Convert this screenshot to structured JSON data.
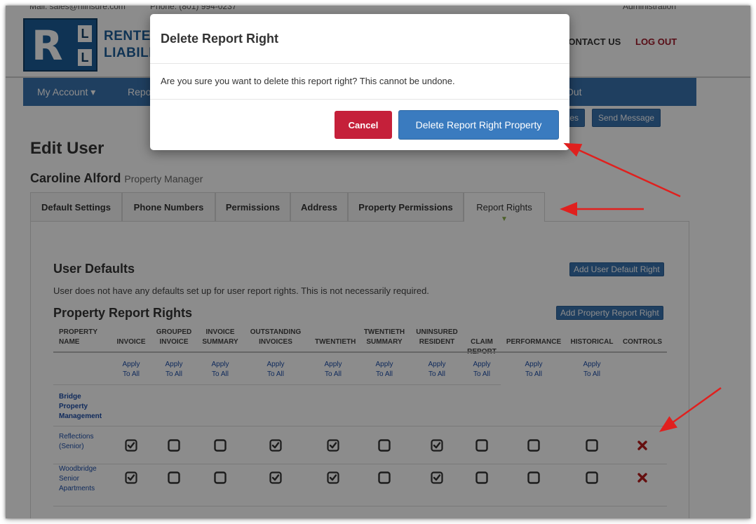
{
  "topbar": {
    "email": "Mail: sales@rllinsure.com",
    "phone": "Phone: (801) 994-0237",
    "admin": "Administration"
  },
  "logo": {
    "letters": {
      "big": "R",
      "small_top": "L",
      "small_bottom": "L"
    },
    "line1": "RENTE",
    "line2": "LIABILI"
  },
  "header_links": {
    "contact": "CONTACT US",
    "logout": "LOG OUT"
  },
  "nav": {
    "my_account": "My Account ▾",
    "reports": "Repo",
    "logout": "Out"
  },
  "toolbar": {
    "messages": "ges",
    "send_message": "Send Message"
  },
  "page": {
    "title": "Edit User",
    "user_name": "Caroline Alford",
    "user_role": "Property Manager"
  },
  "tabs": [
    "Default Settings",
    "Phone Numbers",
    "Permissions",
    "Address",
    "Property Permissions",
    "Report Rights"
  ],
  "active_tab": "Report Rights",
  "user_defaults": {
    "heading": "User Defaults",
    "message": "User does not have any defaults set up for user report rights. This is not necessarily required.",
    "add_button": "Add User Default Right"
  },
  "property_rights": {
    "heading": "Property Report Rights",
    "add_button": "Add Property Report Right",
    "columns": [
      "PROPERTY NAME",
      "INVOICE",
      "GROUPED INVOICE",
      "INVOICE SUMMARY",
      "OUTSTANDING INVOICES",
      "TWENTIETH",
      "TWENTIETH SUMMARY",
      "UNINSURED RESIDENT",
      "CLAIM REPORT",
      "PERFORMANCE",
      "HISTORICAL",
      "CONTROLS"
    ],
    "apply_label": "Apply To All",
    "group_name": "Bridge Property Management",
    "rows": [
      {
        "name": "Reflections (Senior)",
        "checks": [
          true,
          false,
          false,
          true,
          true,
          false,
          true,
          false,
          false,
          false
        ]
      },
      {
        "name": "Woodbridge Senior Apartments",
        "checks": [
          true,
          false,
          false,
          true,
          true,
          false,
          true,
          false,
          false,
          false
        ]
      }
    ]
  },
  "modal": {
    "title": "Delete Report Right",
    "body": "Are you sure you want to delete this report right? This cannot be undone.",
    "cancel": "Cancel",
    "confirm": "Delete Report Right Property"
  },
  "colors": {
    "nav_blue": "#3a73b0",
    "cancel_red": "#c5203a",
    "confirm_blue": "#3a7bbf",
    "delete_x": "#b81c1c",
    "annotation_arrow": "#e0201e"
  }
}
